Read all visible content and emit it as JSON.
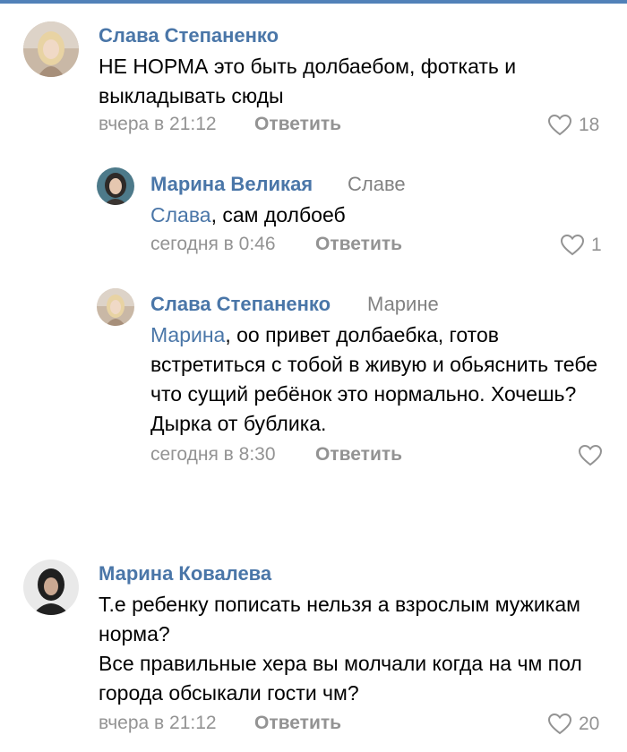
{
  "comments": [
    {
      "author": "Слава Степаненко",
      "to": "",
      "mention": "",
      "text": "НЕ НОРМА это быть долбаебом, фоткать и выкладывать сюды",
      "time": "вчера в 21:12",
      "reply_label": "Ответить",
      "likes": "18"
    },
    {
      "author": "Марина Великая",
      "to": "Славе",
      "mention": "Слава",
      "text": ", сам долбоеб",
      "time": "сегодня в 0:46",
      "reply_label": "Ответить",
      "likes": "1"
    },
    {
      "author": "Слава Степаненко",
      "to": "Марине",
      "mention": "Марина",
      "text": ", оо привет долбаебка, готов встретиться с тобой в живую и обьяснить тебе что сущий ребёнок это нормально. Хочешь? Дырка от бублика.",
      "time": "сегодня в 8:30",
      "reply_label": "Ответить",
      "likes": ""
    },
    {
      "author": "Марина Ковалева",
      "to": "",
      "mention": "",
      "text": "Т.е ребенку пописать нельзя а взрослым мужикам норма?\nВсе правильные хера  вы молчали когда на чм пол города обсыкали гости чм?",
      "time": "вчера в 21:12",
      "reply_label": "Ответить",
      "likes": "20"
    }
  ],
  "colors": {
    "link": "#4a76a8",
    "meta": "#939393",
    "accent": "#5181b8"
  }
}
